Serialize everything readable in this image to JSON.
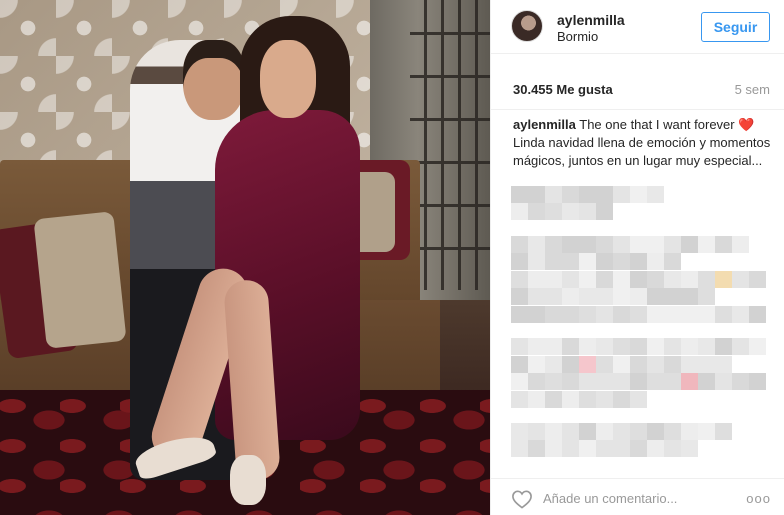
{
  "post": {
    "image_alt": "Couple sitting on a wooden bench",
    "username": "aylenmilla",
    "location": "Bormio",
    "follow_label": "Seguir",
    "likes": "30.455 Me gusta",
    "age": "5 sem",
    "caption": {
      "username": "aylenmilla",
      "text": " The one that I want forever ",
      "emoji": "❤️",
      "text2": " Linda navidad llena de emoción y momentos mágicos, juntos en un lugar muy especial..."
    },
    "comment_placeholder": "Añade un comentario...",
    "more_label": "ooo"
  },
  "colors": {
    "accent": "#3897f0",
    "text": "#262626",
    "muted": "#999999",
    "heart": "#e0245e"
  },
  "icons": {
    "like": "heart-outline-icon",
    "more": "more-options-icon"
  }
}
